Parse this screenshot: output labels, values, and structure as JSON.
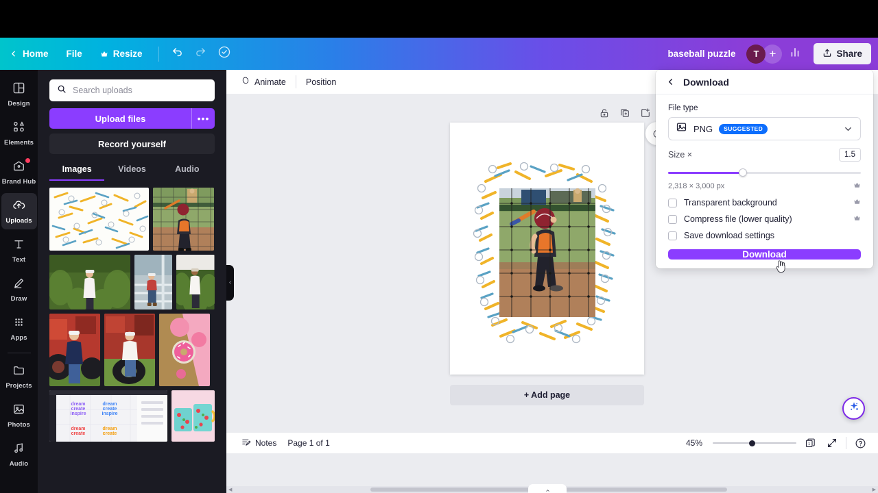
{
  "topbar": {
    "home_label": "Home",
    "file_label": "File",
    "resize_label": "Resize",
    "undo_icon": "undo-icon",
    "redo_icon": "redo-icon",
    "cloud_icon": "cloud-saved-icon",
    "doc_title": "baseball puzzle",
    "avatar_initial": "T",
    "add_member_label": "+",
    "insights_icon": "insights-icon",
    "share_label": "Share"
  },
  "sidebar": {
    "items": [
      {
        "label": "Design",
        "icon": "design-icon",
        "active": false,
        "badge": false
      },
      {
        "label": "Elements",
        "icon": "elements-icon",
        "active": false,
        "badge": false
      },
      {
        "label": "Brand Hub",
        "icon": "brand-hub-icon",
        "active": false,
        "badge": true
      },
      {
        "label": "Uploads",
        "icon": "uploads-icon",
        "active": true,
        "badge": false
      },
      {
        "label": "Text",
        "icon": "text-icon",
        "active": false,
        "badge": false
      },
      {
        "label": "Draw",
        "icon": "draw-icon",
        "active": false,
        "badge": false
      },
      {
        "label": "Apps",
        "icon": "apps-icon",
        "active": false,
        "badge": false
      },
      {
        "label": "Projects",
        "icon": "projects-icon",
        "active": false,
        "badge": false
      },
      {
        "label": "Photos",
        "icon": "photos-icon",
        "active": false,
        "badge": false
      },
      {
        "label": "Audio",
        "icon": "audio-icon",
        "active": false,
        "badge": false
      }
    ]
  },
  "uploads_panel": {
    "search_placeholder": "Search uploads",
    "search_value": "",
    "upload_files_label": "Upload files",
    "more_label": "•••",
    "record_label": "Record yourself",
    "tabs": [
      {
        "label": "Images",
        "active": true
      },
      {
        "label": "Videos",
        "active": false
      },
      {
        "label": "Audio",
        "active": false
      }
    ]
  },
  "editor_toolbar": {
    "animate_label": "Animate",
    "position_label": "Position",
    "collapse_icon": "chevron-left-icon"
  },
  "canvas": {
    "lock_icon": "lock-icon",
    "duplicate_icon": "duplicate-page-icon",
    "add_page_icon": "add-page-icon",
    "add_page_label": "+ Add page",
    "magic_icon": "magic-studio-icon"
  },
  "bottombar": {
    "notes_label": "Notes",
    "page_indicator": "Page 1 of 1",
    "zoom_level": "45%",
    "page_count_icon": "page-count-icon",
    "fullscreen_icon": "fullscreen-icon",
    "help_icon": "help-icon",
    "help_label": "?",
    "page_number": "1"
  },
  "download_panel": {
    "back_icon": "chevron-left-icon",
    "title": "Download",
    "file_type_label": "File type",
    "file_type_value": "PNG",
    "file_type_icon": "png-image-icon",
    "suggested_badge": "SUGGESTED",
    "chevron_icon": "chevron-down-icon",
    "size_label": "Size ×",
    "size_value": "1.5",
    "dimensions": "2,318 × 3,000 px",
    "crown_icon": "crown-icon",
    "options": [
      {
        "label": "Transparent background",
        "checked": false,
        "pro": true
      },
      {
        "label": "Compress file (lower quality)",
        "checked": false,
        "pro": true
      },
      {
        "label": "Save download settings",
        "checked": false,
        "pro": false
      }
    ],
    "download_button_label": "Download"
  },
  "colors": {
    "brand_purple": "#8b3dff",
    "accent_blue": "#0d6efd",
    "topbar_cyan": "#00c4cc",
    "topbar_violet": "#8b3dd8",
    "rail_bg": "#0e0e13",
    "panel_bg": "#1b1b23",
    "canvas_bg": "#ebecf0",
    "badge_red": "#ff3c5f"
  }
}
